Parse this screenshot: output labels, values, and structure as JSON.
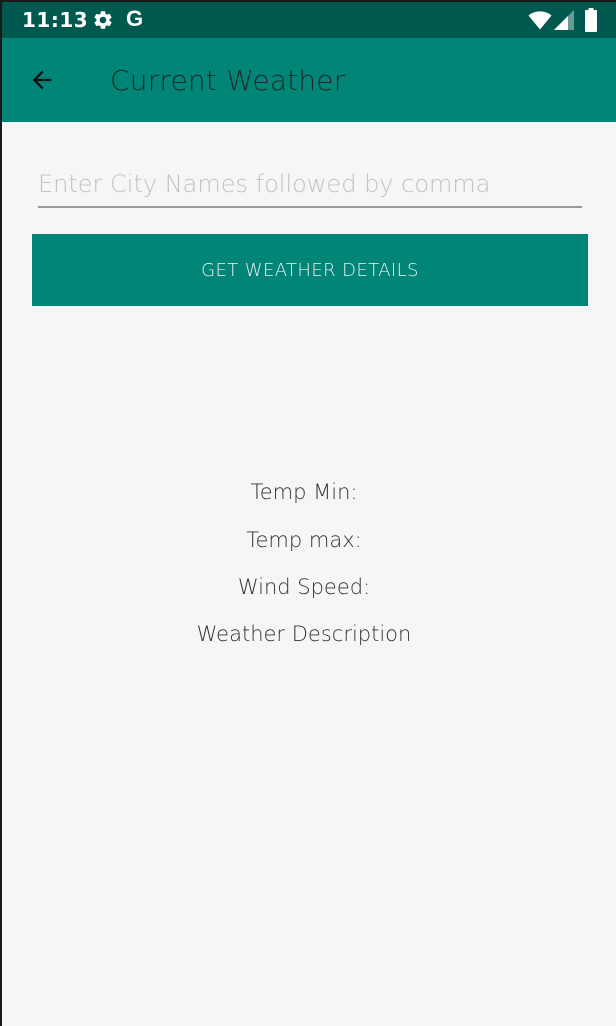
{
  "status_bar": {
    "time": "11:13",
    "icons": [
      "gear-icon",
      "google-g-icon",
      "wifi-icon",
      "cell-signal-icon",
      "battery-icon"
    ],
    "google_letter": "G"
  },
  "app_bar": {
    "title": "Current Weather",
    "back_icon": "arrow-back-icon",
    "color": "#008577"
  },
  "form": {
    "city_input_value": "",
    "city_input_placeholder": "Enter City Names followed by comma",
    "submit_label": "GET WEATHER DETAILS"
  },
  "results": {
    "temp_min_label": "Temp Min:",
    "temp_max_label": "Temp max:",
    "wind_speed_label": "Wind Speed:",
    "weather_description_label": "Weather Description"
  },
  "colors": {
    "status_bar": "#00594f",
    "primary": "#008577",
    "background": "#f5f6f8"
  }
}
